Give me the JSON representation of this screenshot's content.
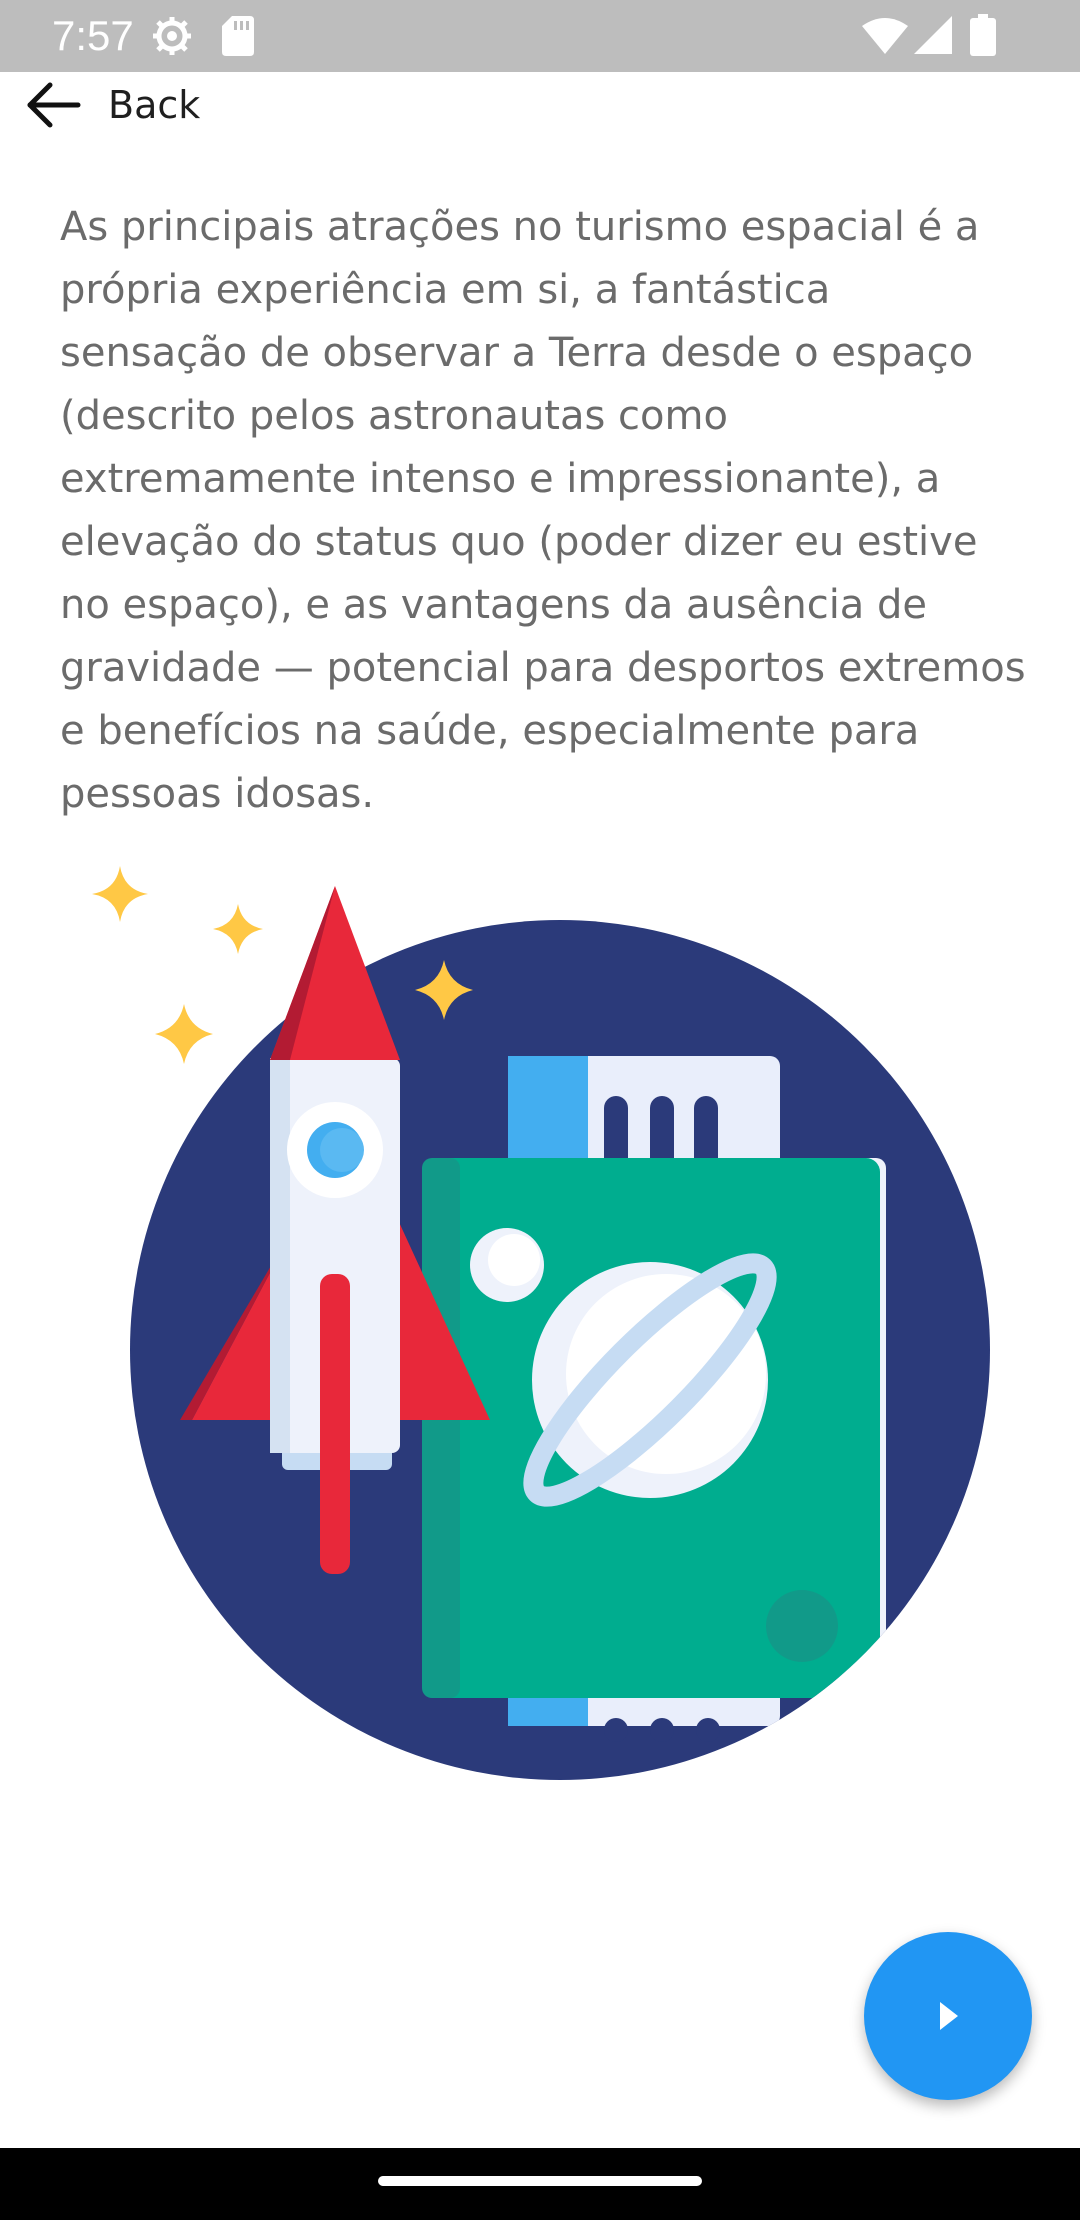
{
  "status_bar": {
    "time": "7:57",
    "icons": [
      "settings-gear-icon",
      "sd-card-icon",
      "wifi-icon",
      "cell-signal-icon",
      "battery-icon"
    ]
  },
  "header": {
    "back_label": "Back",
    "back_icon": "arrow-left-icon"
  },
  "content": {
    "paragraph": "As principais atrações no turismo espacial é a própria experiência em si, a fantástica sensação de observar a Terra desde o espaço (descrito pelos astronautas como extremamente intenso e impressionante), a elevação do status quo (poder dizer eu estive no espaço), e as vantagens da ausência de gravidade — potencial para desportos extremos e benefícios na saúde, especialmente para pessoas idosas.",
    "illustration": "rocket-passport-planet-illustration"
  },
  "fab": {
    "icon": "play-arrow-icon",
    "color": "#2196f3"
  },
  "colors": {
    "status_bar": "#bdbdbd",
    "text": "#6b6b6b",
    "circle": "#2b3a7a",
    "passport": "#00ad8f",
    "rocket_fin": "#e8283a",
    "star": "#ffc845"
  }
}
